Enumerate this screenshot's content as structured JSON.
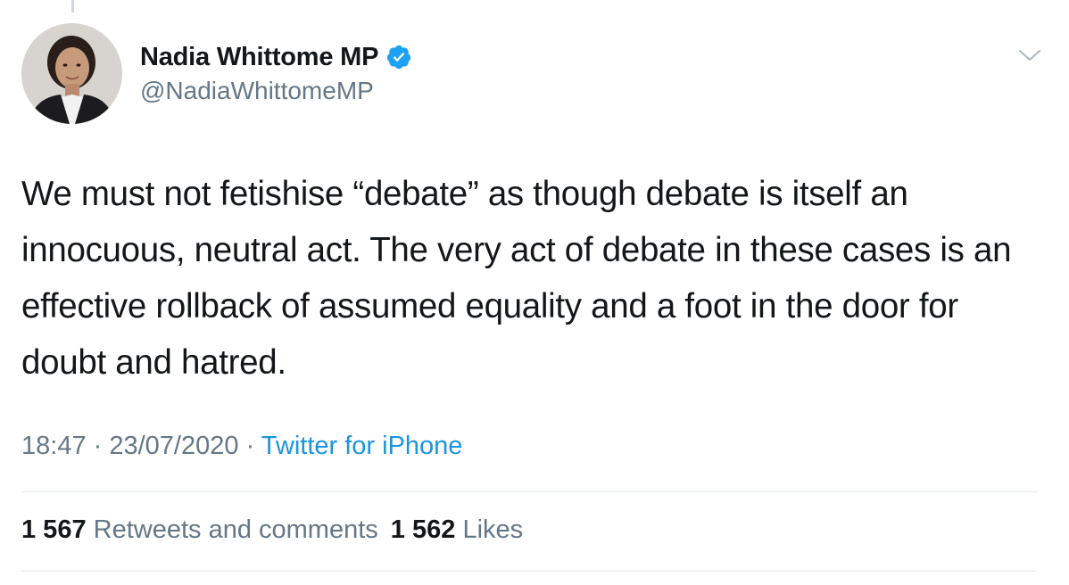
{
  "author": {
    "display_name": "Nadia Whittome MP",
    "handle": "@NadiaWhittomeMP",
    "verified": true,
    "avatar_icon": "profile-photo"
  },
  "tweet": {
    "text": "We must not fetishise “debate” as though debate is itself an innocuous, neutral act. The very act of debate in these cases is an effective rollback of assumed equality and a foot in the door for doubt and hatred."
  },
  "meta": {
    "time": "18:47",
    "separator": " · ",
    "date": "23/07/2020",
    "source": "Twitter for iPhone"
  },
  "stats": {
    "retweets_count": "1 567",
    "retweets_label": "Retweets and comments",
    "likes_count": "1 562",
    "likes_label": "Likes"
  },
  "colors": {
    "text_primary": "#14171a",
    "text_secondary": "#657786",
    "accent": "#1b95e0",
    "verified_badge": "#1da1f2",
    "divider": "#e1e8ed"
  }
}
